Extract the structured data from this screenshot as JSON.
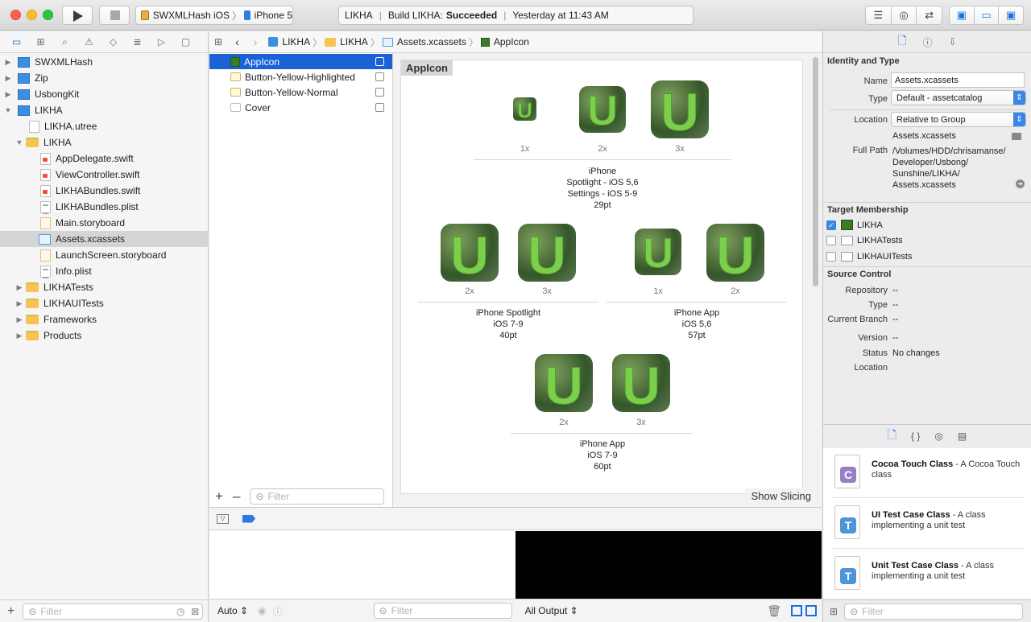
{
  "toolbar": {
    "scheme": "SWXMLHash iOS",
    "device": "iPhone 5",
    "status_project": "LIKHA",
    "status_build_prefix": "Build LIKHA:",
    "status_build_result": "Succeeded",
    "status_time": "Yesterday at 11:43 AM"
  },
  "navigator": {
    "items": [
      {
        "label": "SWXMLHash"
      },
      {
        "label": "Zip"
      },
      {
        "label": "UsbongKit"
      },
      {
        "label": "LIKHA"
      },
      {
        "label": "LIKHA.utree"
      },
      {
        "label": "LIKHA"
      },
      {
        "label": "AppDelegate.swift"
      },
      {
        "label": "ViewController.swift"
      },
      {
        "label": "LIKHABundles.swift"
      },
      {
        "label": "LIKHABundles.plist"
      },
      {
        "label": "Main.storyboard"
      },
      {
        "label": "Assets.xcassets"
      },
      {
        "label": "LaunchScreen.storyboard"
      },
      {
        "label": "Info.plist"
      },
      {
        "label": "LIKHATests"
      },
      {
        "label": "LIKHAUITests"
      },
      {
        "label": "Frameworks"
      },
      {
        "label": "Products"
      }
    ],
    "filter_placeholder": "Filter"
  },
  "jumpbar": {
    "crumbs": [
      "LIKHA",
      "LIKHA",
      "Assets.xcassets",
      "AppIcon"
    ]
  },
  "assets": {
    "items": [
      {
        "label": "AppIcon"
      },
      {
        "label": "Button-Yellow-Highlighted"
      },
      {
        "label": "Button-Yellow-Normal"
      },
      {
        "label": "Cover"
      }
    ],
    "filter_placeholder": "Filter"
  },
  "canvas": {
    "title": "AppIcon",
    "show_slicing": "Show Slicing",
    "icon_letter": "U",
    "groups": [
      {
        "scales": [
          "1x",
          "2x",
          "3x"
        ],
        "caption": [
          "iPhone",
          "Spotlight - iOS 5,6",
          "Settings - iOS 5-9",
          "29pt"
        ]
      },
      {
        "scales": [
          "2x",
          "3x"
        ],
        "caption": [
          "iPhone Spotlight",
          "iOS 7-9",
          "40pt"
        ]
      },
      {
        "scales": [
          "1x",
          "2x"
        ],
        "caption": [
          "iPhone App",
          "iOS 5,6",
          "57pt"
        ]
      },
      {
        "scales": [
          "2x",
          "3x"
        ],
        "caption": [
          "iPhone App",
          "iOS 7-9",
          "60pt"
        ]
      }
    ]
  },
  "debug": {
    "auto_label": "Auto",
    "filter_placeholder": "Filter",
    "output_label": "All Output"
  },
  "inspector": {
    "identity_title": "Identity and Type",
    "name_label": "Name",
    "name_value": "Assets.xcassets",
    "type_label": "Type",
    "type_value": "Default - assetcatalog",
    "location_label": "Location",
    "location_value": "Relative to Group",
    "location_file": "Assets.xcassets",
    "fullpath_label": "Full Path",
    "fullpath_lines": [
      "/Volumes/HDD/chrisamanse/",
      "Developer/Usbong/",
      "Sunshine/LIKHA/",
      "Assets.xcassets"
    ],
    "target_title": "Target Membership",
    "targets": [
      {
        "label": "LIKHA",
        "checked": true
      },
      {
        "label": "LIKHATests",
        "checked": false
      },
      {
        "label": "LIKHAUITests",
        "checked": false
      }
    ],
    "source_title": "Source Control",
    "repo_label": "Repository",
    "repo_value": "--",
    "sc_type_label": "Type",
    "sc_type_value": "--",
    "branch_label": "Current Branch",
    "branch_value": "--",
    "version_label": "Version",
    "version_value": "--",
    "status_label": "Status",
    "status_value": "No changes",
    "sc_location_label": "Location"
  },
  "library": {
    "items": [
      {
        "title": "Cocoa Touch Class",
        "desc": " - A Cocoa Touch class",
        "glyph": "C",
        "color": "#9b7fc6"
      },
      {
        "title": "UI Test Case Class",
        "desc": " - A class implementing a unit test",
        "glyph": "T",
        "color": "#4c95d6"
      },
      {
        "title": "Unit Test Case Class",
        "desc": " - A class implementing a unit test",
        "glyph": "T",
        "color": "#4c95d6"
      }
    ],
    "filter_placeholder": "Filter"
  }
}
